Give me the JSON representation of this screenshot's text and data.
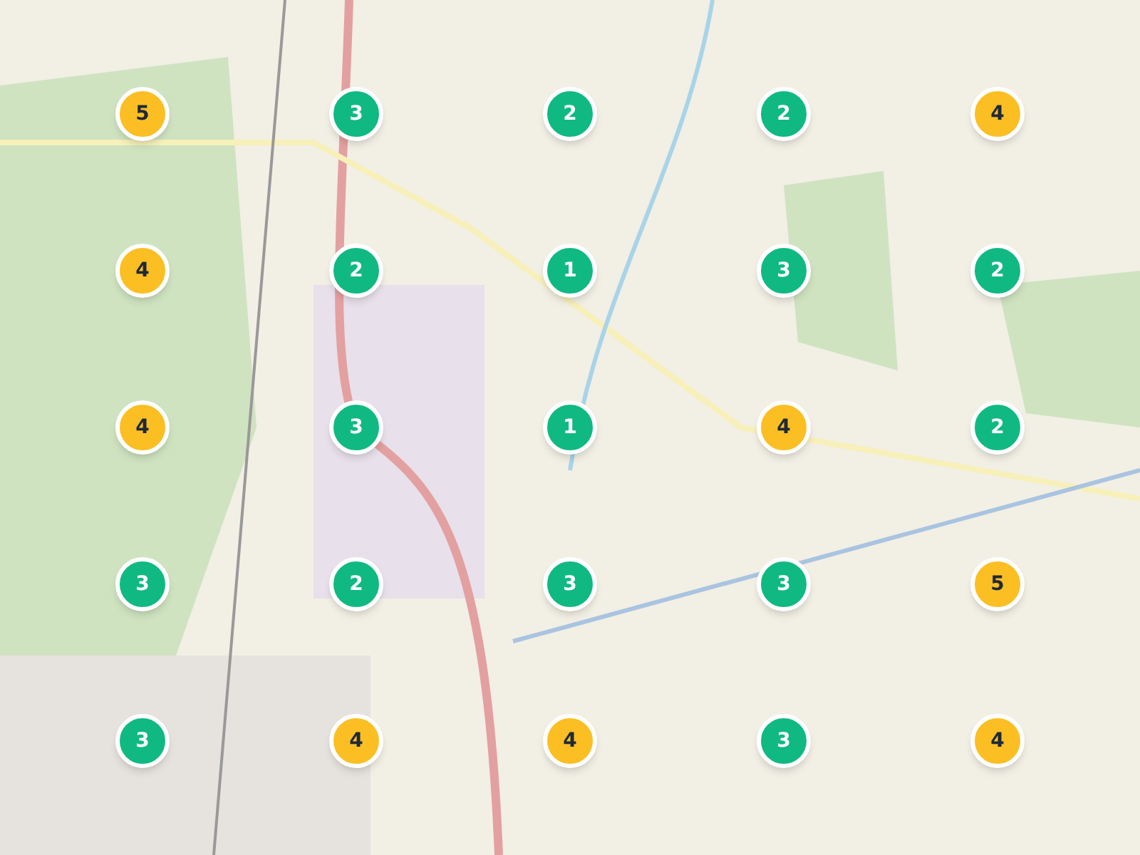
{
  "markers": [
    {
      "count": "5",
      "color": "#fbbf24"
    },
    {
      "count": "3",
      "color": "#10b981"
    },
    {
      "count": "2",
      "color": "#10b981"
    },
    {
      "count": "2",
      "color": "#10b981"
    },
    {
      "count": "4",
      "color": "#fbbf24"
    },
    {
      "count": "4",
      "color": "#fbbf24"
    },
    {
      "count": "2",
      "color": "#10b981"
    },
    {
      "count": "1",
      "color": "#10b981"
    },
    {
      "count": "3",
      "color": "#10b981"
    },
    {
      "count": "2",
      "color": "#10b981"
    },
    {
      "count": "4",
      "color": "#fbbf24"
    },
    {
      "count": "3",
      "color": "#10b981"
    },
    {
      "count": "1",
      "color": "#10b981"
    },
    {
      "count": "4",
      "color": "#fbbf24"
    },
    {
      "count": "2",
      "color": "#10b981"
    },
    {
      "count": "3",
      "color": "#10b981"
    },
    {
      "count": "2",
      "color": "#10b981"
    },
    {
      "count": "3",
      "color": "#10b981"
    },
    {
      "count": "3",
      "color": "#10b981"
    },
    {
      "count": "5",
      "color": "#fbbf24"
    },
    {
      "count": "3",
      "color": "#10b981"
    },
    {
      "count": "4",
      "color": "#fbbf24"
    },
    {
      "count": "4",
      "color": "#fbbf24"
    },
    {
      "count": "3",
      "color": "#10b981"
    },
    {
      "count": "4",
      "color": "#fbbf24"
    }
  ]
}
